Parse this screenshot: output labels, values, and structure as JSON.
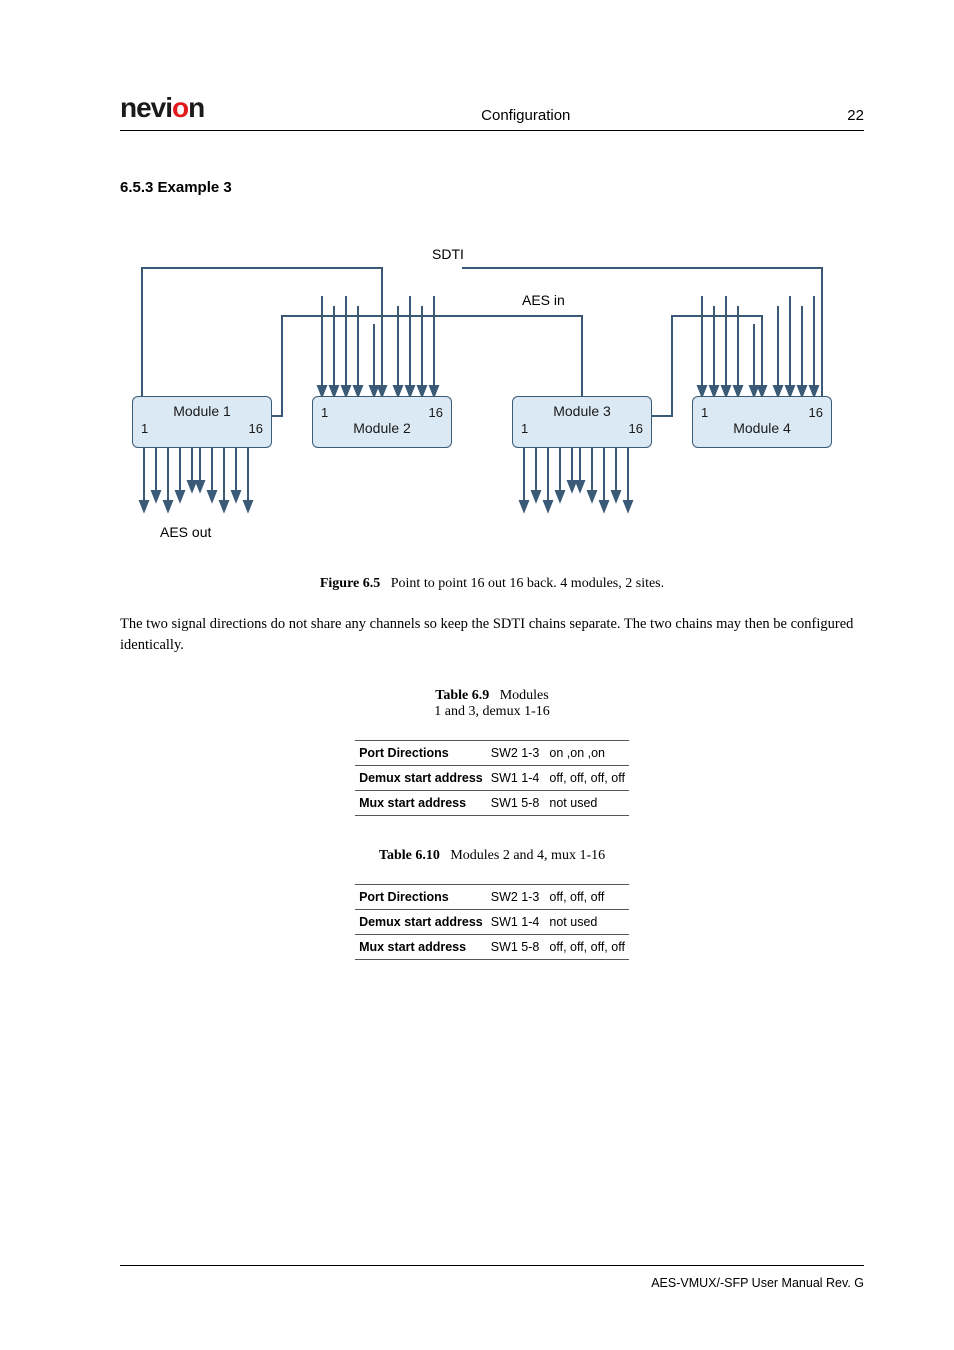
{
  "header": {
    "brand_prefix": "nevi",
    "brand_accent": "o",
    "brand_suffix": "n",
    "title": "Configuration",
    "page": "22"
  },
  "section": {
    "number_title": "6.5.3  Example 3"
  },
  "diagram": {
    "sdti": "SDTI",
    "aes_in": "AES in",
    "aes_out": "AES out",
    "mod1": {
      "name": "Module 1",
      "lo": "1",
      "hi": "16"
    },
    "mod2": {
      "name": "Module 2",
      "lo": "1",
      "hi": "16"
    },
    "mod3": {
      "name": "Module 3",
      "lo": "1",
      "hi": "16"
    },
    "mod4": {
      "name": "Module 4",
      "lo": "1",
      "hi": "16"
    }
  },
  "figure": {
    "label": "Figure 6.5",
    "text": "Point to point 16 out 16 back.  4 modules, 2 sites."
  },
  "paragraph": "The two signal directions do not share any channels so keep the SDTI chains separate. The two chains may then be configured identically.",
  "table9": {
    "label": "Table 6.9",
    "text_l1": "Modules",
    "text_l2": "1 and 3, demux 1-16",
    "rows": [
      {
        "k": "Port Directions",
        "s": "SW2 1-3",
        "v": "on ,on ,on"
      },
      {
        "k": "Demux start address",
        "s": "SW1 1-4",
        "v": "off, off, off, off"
      },
      {
        "k": "Mux start address",
        "s": "SW1 5-8",
        "v": "not used"
      }
    ]
  },
  "table10": {
    "label": "Table 6.10",
    "text": "Modules 2 and 4, mux 1-16",
    "rows": [
      {
        "k": "Port Directions",
        "s": "SW2 1-3",
        "v": "off, off, off"
      },
      {
        "k": "Demux start address",
        "s": "SW1 1-4",
        "v": "not used"
      },
      {
        "k": "Mux start address",
        "s": "SW1 5-8",
        "v": "off, off, off, off"
      }
    ]
  },
  "footer": "AES-VMUX/-SFP User Manual Rev. G"
}
